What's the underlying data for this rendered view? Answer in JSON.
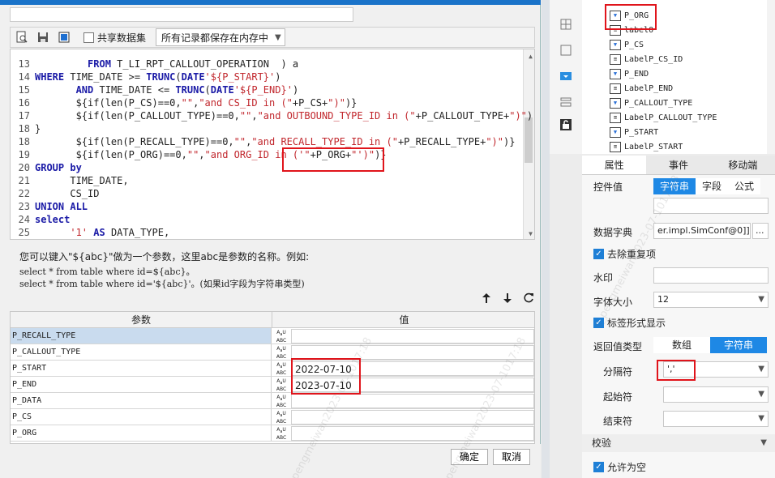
{
  "toolbar": {
    "share_dataset_label": "共享数据集",
    "storage_select_value": "所有记录都保存在内存中"
  },
  "editor": {
    "lines": [
      {
        "num": "13",
        "text": "         FROM T_LI_RPT_CALLOUT_OPERATION  ) a"
      },
      {
        "num": "14",
        "text": "WHERE TIME_DATE >= TRUNC(DATE'${P_START}')"
      },
      {
        "num": "15",
        "text": "       AND TIME_DATE <= TRUNC(DATE'${P_END}')"
      },
      {
        "num": "16",
        "text": "       ${if(len(P_CS)==0,\"\",\"and CS_ID in (\"+P_CS+\")\")}"
      },
      {
        "num": "17",
        "text": "       ${if(len(P_CALLOUT_TYPE)==0,\"\",\"and OUTBOUND_TYPE_ID in (\"+P_CALLOUT_TYPE+\")\")"
      },
      {
        "num": "18",
        "text": "}"
      },
      {
        "num": "18",
        "text": "       ${if(len(P_RECALL_TYPE)==0,\"\",\"and RECALL_TYPE_ID in (\"+P_RECALL_TYPE+\")\")}"
      },
      {
        "num": "19",
        "text": "       ${if(len(P_ORG)==0,\"\",\"and ORG_ID in ('\"+P_ORG+\"')\")}"
      },
      {
        "num": "20",
        "text": "GROUP by"
      },
      {
        "num": "21",
        "text": "      TIME_DATE,"
      },
      {
        "num": "22",
        "text": "      CS_ID"
      },
      {
        "num": "23",
        "text": "UNION ALL"
      },
      {
        "num": "24",
        "text": "select"
      },
      {
        "num": "25",
        "text": "      '1' AS DATA_TYPE,"
      }
    ]
  },
  "help": {
    "line1": "您可以键入\"${abc}\"做为一个参数，这里abc是参数的名称。例如:",
    "line2": "select * from table where id=${abc}。",
    "line3": "select * from table where id='${abc}'。(如果id字段为字符串类型)"
  },
  "params": {
    "col_param": "参数",
    "col_value": "值",
    "type_icon_text": "ABC",
    "rows": [
      {
        "name": "P_RECALL_TYPE",
        "value": ""
      },
      {
        "name": "P_CALLOUT_TYPE",
        "value": ""
      },
      {
        "name": "P_START",
        "value": "2022-07-10"
      },
      {
        "name": "P_END",
        "value": "2023-07-10"
      },
      {
        "name": "P_DATA",
        "value": ""
      },
      {
        "name": "P_CS",
        "value": ""
      },
      {
        "name": "P_ORG",
        "value": ""
      }
    ]
  },
  "buttons": {
    "ok": "确定",
    "cancel": "取消"
  },
  "tree": {
    "items": [
      "P_ORG",
      "label0",
      "P_CS",
      "LabelP_CS_ID",
      "P_END",
      "LabelP_END",
      "P_CALLOUT_TYPE",
      "LabelP_CALLOUT_TYPE",
      "P_START",
      "LabelP_START"
    ]
  },
  "tabs": [
    "属性",
    "事件",
    "移动端"
  ],
  "props": {
    "control_value_label": "控件值",
    "control_value_options": [
      "字符串",
      "字段",
      "公式"
    ],
    "dict_label": "数据字典",
    "dict_value": "er.impl.SimConf@0]]",
    "dict_more": "...",
    "dedupe_label": "去除重复项",
    "watermark_label": "水印",
    "font_size_label": "字体大小",
    "font_size_value": "12",
    "label_display_label": "标签形式显示",
    "return_type_label": "返回值类型",
    "return_type_options": [
      "数组",
      "字符串"
    ],
    "separator_label": "分隔符",
    "separator_value": "','",
    "start_char_label": "起始符",
    "end_char_label": "结束符",
    "validation_label": "校验",
    "allow_empty_label": "允许为空"
  },
  "watermark_text": "c_pengmeiwan2023-07-1017:18"
}
